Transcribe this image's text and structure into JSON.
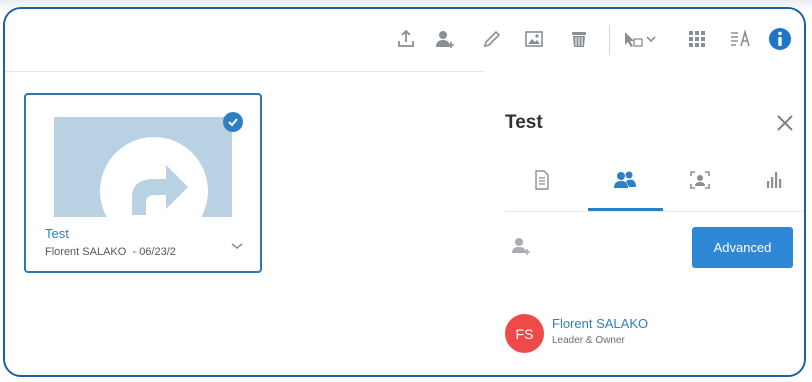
{
  "toolbar": {
    "icons": [
      "upload-icon",
      "add-user-icon",
      "pencil-icon",
      "image-icon",
      "trash-icon",
      "select-cursor-icon",
      "grid-view-icon",
      "sort-icon",
      "info-icon"
    ]
  },
  "card": {
    "title": "Test",
    "owner": "Florent SALAKO",
    "date_separator": "-",
    "date": "06/23/2"
  },
  "panel": {
    "title": "Test",
    "tabs": [
      {
        "icon": "document-icon",
        "active": false
      },
      {
        "icon": "people-icon",
        "active": true
      },
      {
        "icon": "face-scan-icon",
        "active": false
      },
      {
        "icon": "bar-chart-icon",
        "active": false
      }
    ],
    "advanced_label": "Advanced",
    "member": {
      "initials": "FS",
      "name": "Florent SALAKO",
      "role": "Leader & Owner"
    }
  },
  "colors": {
    "accent": "#2e80c4",
    "avatar": "#ef4a4a",
    "thumbnail": "#b8d1e3"
  }
}
